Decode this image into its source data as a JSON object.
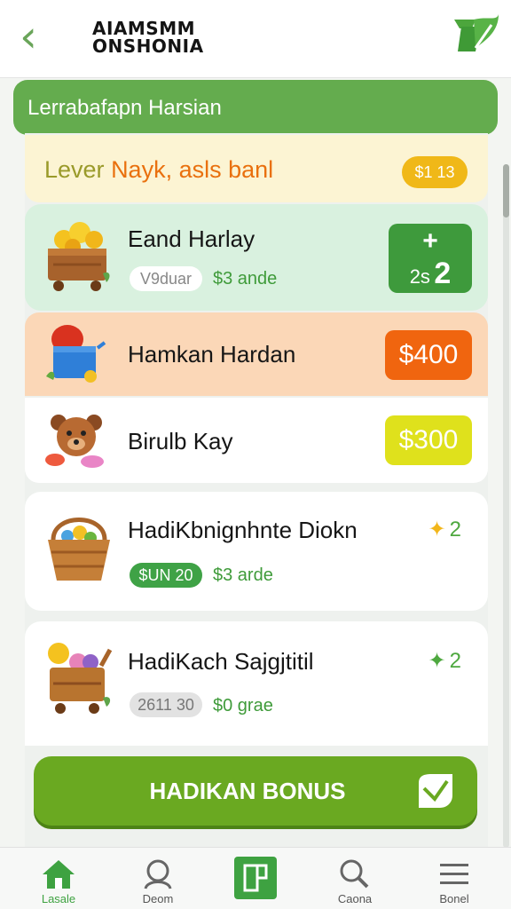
{
  "header": {
    "back_icon": "chevron-left-icon",
    "title_line1": "AIAMSMM",
    "title_line2": "ONSHONIA",
    "logo_icon": "brand-leaf-icon"
  },
  "banner": {
    "text": "Lerrabafapn Harsian"
  },
  "level": {
    "label_a": "Lever",
    "label_b": "Nayk, asls banl",
    "badge": "$1 13"
  },
  "items": [
    {
      "title": "Eand Harlay",
      "pill": "V9duar",
      "price": "$3 ande",
      "action_top": "+",
      "action_bottom_left": "2s",
      "action_bottom_right": "2",
      "icon": "coin-cart-icon",
      "bg": "#d9f1df",
      "accent": "#3e9a3c"
    },
    {
      "title": "Hamkan Hardan",
      "price_box": "$400",
      "icon": "bucket-icon",
      "bg": "#fbd7b7",
      "accent": "#f0650f"
    },
    {
      "title": "Birulb Kay",
      "price_box": "$300",
      "icon": "teddy-bear-icon",
      "bg": "#ffffff",
      "accent": "#dfe11c"
    },
    {
      "title": "HadiKbnignhnte Diokn",
      "pill": "$UN 20",
      "price": "$3 arde",
      "star_count": "2",
      "icon": "basket-icon",
      "bg": "#ffffff",
      "accent": "#3fa246"
    },
    {
      "title": "HadiKach Sajgjtitil",
      "pill": "2611 30",
      "price": "$0 grae",
      "star_count": "2",
      "icon": "gift-cart-icon",
      "bg": "#ffffff",
      "accent": "#d6d6d6"
    }
  ],
  "bonus_button": {
    "label": "HADIKAN BONUS",
    "icon": "leaf-arrow-icon"
  },
  "nav": [
    {
      "label": "Lasale",
      "icon": "home-icon",
      "active": true
    },
    {
      "label": "Deom",
      "icon": "user-icon"
    },
    {
      "label": "",
      "icon": "tile-icon"
    },
    {
      "label": "Caona",
      "icon": "search-icon"
    },
    {
      "label": "Bonel",
      "icon": "menu-icon"
    }
  ],
  "colors": {
    "brand_green": "#64ac4e",
    "orange": "#f0650f",
    "yellow": "#dfe11c",
    "gold": "#f0b818"
  }
}
